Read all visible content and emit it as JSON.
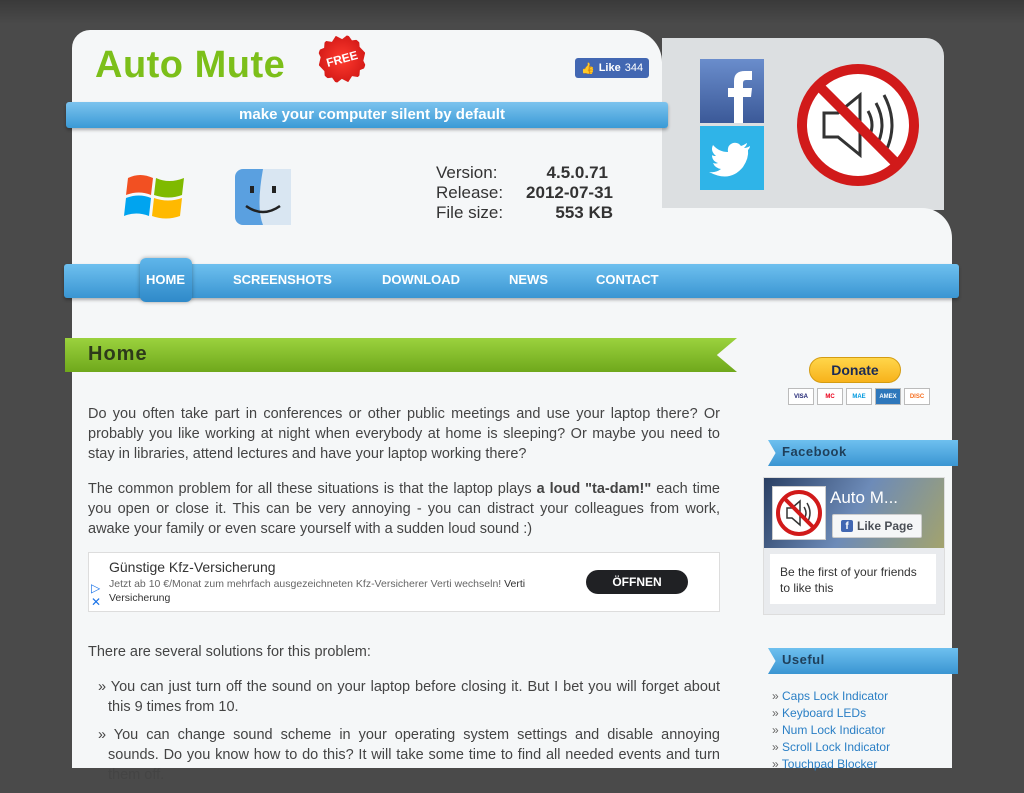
{
  "header": {
    "title": "Auto Mute",
    "free_badge": "FREE",
    "like_label": "Like",
    "like_count": "344",
    "tagline": "make your computer silent by default"
  },
  "info": {
    "version_label": "Version:",
    "version": "4.5.0.71",
    "release_label": "Release:",
    "release": "2012-07-31",
    "size_label": "File size:",
    "size": "553 KB"
  },
  "nav": {
    "items": [
      "HOME",
      "SCREENSHOTS",
      "DOWNLOAD",
      "NEWS",
      "CONTACT"
    ]
  },
  "main": {
    "heading": "Home",
    "p1": "Do you often take part in conferences or other public meetings and use your laptop there? Or probably you like working at night when everybody at home is sleeping? Or maybe you need to stay in libraries, attend lectures and have your laptop working there?",
    "p2_before": "The common problem for all these situations is that the laptop plays ",
    "p2_bold": "a loud \"ta-dam!\"",
    "p2_after": " each time you open or close it. This can be very annoying - you can distract your colleagues from work, awake your family or even scare yourself with a sudden loud sound :)",
    "p3": "There are several solutions for this problem:",
    "li1": "» You can just turn off the sound on your laptop before closing it. But I bet you will forget about this 9 times from 10.",
    "li2": "» You can change sound scheme in your operating system settings and disable annoying sounds. Do you know how to do this? It will take some time to find all needed events and turn them off."
  },
  "ad": {
    "title": "Günstige Kfz-Versicherung",
    "text": "Jetzt ab 10 €/Monat zum mehrfach ausgezeichneten Kfz-Versicherer Verti wechseln!",
    "brand": "Verti Versicherung",
    "button": "ÖFFNEN"
  },
  "sidebar": {
    "donate": "Donate",
    "cards": [
      "VISA",
      "MC",
      "MAE",
      "AMEX",
      "DISC"
    ],
    "facebook_heading": "Facebook",
    "fb_page_name": "Auto M...",
    "fb_like_page": "Like Page",
    "fb_first": "Be the first of your friends to like this",
    "useful_heading": "Useful",
    "useful_links": [
      "Caps Lock Indicator",
      "Keyboard LEDs",
      "Num Lock Indicator",
      "Scroll Lock Indicator",
      "Touchpad Blocker"
    ]
  },
  "colors": {
    "title_green": "#7cbf1a",
    "nav_blue": "#3a95d2",
    "link_blue": "#2a7fc5",
    "heading_green": "#8cc531"
  }
}
